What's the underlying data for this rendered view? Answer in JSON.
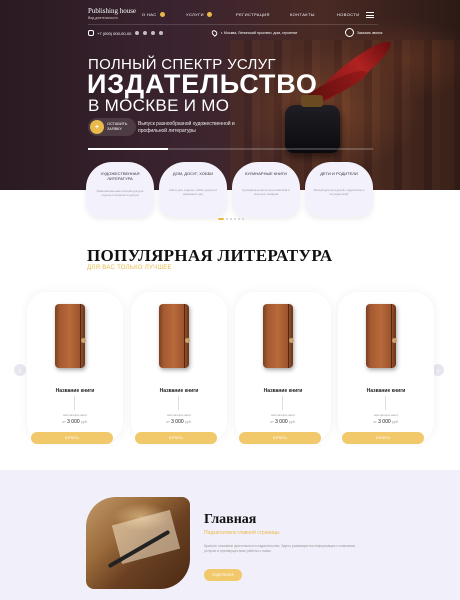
{
  "header": {
    "logo_title": "Publishing house",
    "logo_sub": "Вид деятельности",
    "menu": [
      {
        "label": "О НАС",
        "has_badge": true
      },
      {
        "label": "УСЛУГИ",
        "has_badge": true
      },
      {
        "label": "РЕГИСТРАЦИЯ",
        "has_badge": false
      },
      {
        "label": "КОНТАКТЫ",
        "has_badge": false
      },
      {
        "label": "НОВОСТИ",
        "has_badge": false
      }
    ],
    "phone": "+7 (000) 000-00-00",
    "address": "г. Москва, Ленинский проспект, дом, строение",
    "callback_label": "Заказать звонок"
  },
  "hero": {
    "subtitle": "ПОЛНЫЙ СПЕКТР УСЛУГ",
    "title": "ИЗДАТЕЛЬСТВО",
    "city": "В МОСКВЕ И МО",
    "cta_line1": "ОСТАВИТЬ",
    "cta_line2": "ЗАЯВКУ",
    "description": "Выпуск разнообразной художественной и профильной литературы",
    "slider_progress": 0.28
  },
  "categories": [
    {
      "title": "ХУДОЖЕСТВЕННАЯ ЛИТЕРАТУРА",
      "desc": "Развлекательная литература для отдыха и приятного досуга"
    },
    {
      "title": "ДОМ, ДОСУГ, ХОББИ",
      "desc": "Книги для отдыха, хобби, досуга и домашних дел"
    },
    {
      "title": "КУЛИНАРНЫЕ КНИГИ",
      "desc": "Кулинарные книги для новичков и опытных поваров"
    },
    {
      "title": "ДЕТИ И РОДИТЕЛИ",
      "desc": "Литература для детей, подростков и их родителей"
    }
  ],
  "slider_dots": [
    true,
    false,
    false,
    false,
    false,
    false
  ],
  "popular": {
    "title": "ПОПУЛЯРНАЯ ЛИТЕРАТУРА",
    "subtitle": "ДЛЯ ВАС ТОЛЬКО ЛУЧШЕЕ"
  },
  "products": [
    {
      "name": "Название книги",
      "author": "имя автора книги",
      "price_prefix": "от",
      "price": "3 000",
      "currency": "руб.",
      "button": "КУПИТЬ"
    },
    {
      "name": "Название книги",
      "author": "имя автора книги",
      "price_prefix": "от",
      "price": "3 000",
      "currency": "руб.",
      "button": "КУПИТЬ"
    },
    {
      "name": "Название книги",
      "author": "имя автора книги",
      "price_prefix": "от",
      "price": "3 000",
      "currency": "руб.",
      "button": "КУПИТЬ"
    },
    {
      "name": "Название книги",
      "author": "имя автора книги",
      "price_prefix": "от",
      "price": "3 000",
      "currency": "руб.",
      "button": "КУПИТЬ"
    }
  ],
  "carousel": {
    "prev_icon": "‹",
    "next_icon": "›"
  },
  "lower": {
    "title": "Главная",
    "subtitle": "Подзаголовок главной страницы",
    "text": "Краткое описание деятельности издательства. Здесь размещается информация о компании, услугах и преимуществах работы с нами.",
    "button": "ПОДРОБНЕЕ"
  },
  "colors": {
    "accent": "#e9b94a",
    "button": "#f1c86a",
    "card_bg": "#f3f1fb",
    "section_bg": "#f1eff9"
  }
}
